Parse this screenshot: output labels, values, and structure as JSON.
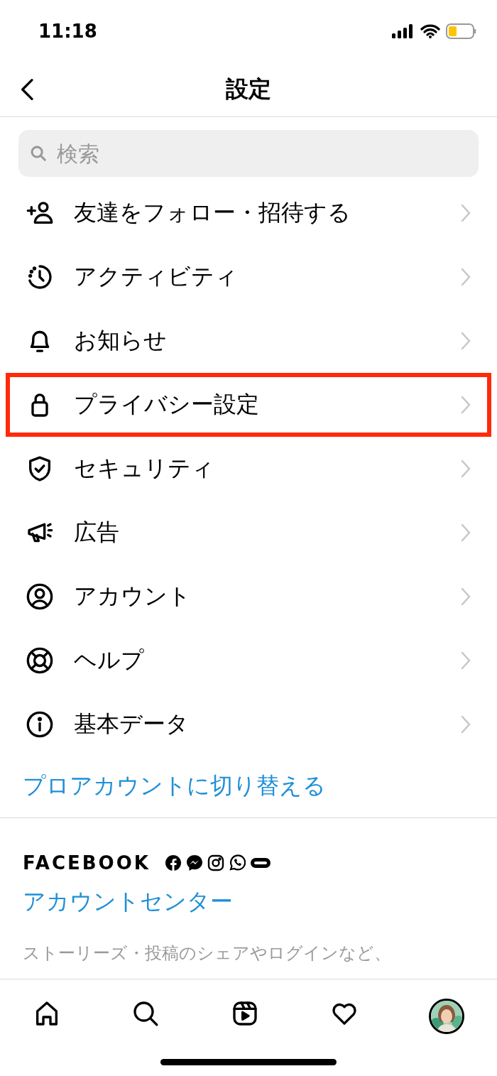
{
  "status_bar": {
    "time": "11:18"
  },
  "header": {
    "title": "設定"
  },
  "search": {
    "placeholder": "検索"
  },
  "menu": [
    {
      "label": "友達をフォロー・招待する",
      "highlighted": false
    },
    {
      "label": "アクティビティ",
      "highlighted": false
    },
    {
      "label": "お知らせ",
      "highlighted": false
    },
    {
      "label": "プライバシー設定",
      "highlighted": true
    },
    {
      "label": "セキュリティ",
      "highlighted": false
    },
    {
      "label": "広告",
      "highlighted": false
    },
    {
      "label": "アカウント",
      "highlighted": false
    },
    {
      "label": "ヘルプ",
      "highlighted": false
    },
    {
      "label": "基本データ",
      "highlighted": false
    }
  ],
  "pro_link": "プロアカウントに切り替える",
  "facebook": {
    "heading": "FACEBOOK",
    "link": "アカウントセンター",
    "description": "ストーリーズ・投稿のシェアやログインなど、"
  }
}
